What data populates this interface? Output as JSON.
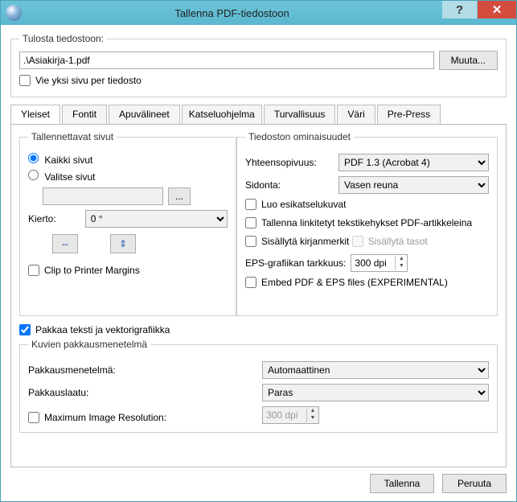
{
  "window": {
    "title": "Tallenna PDF-tiedostoon"
  },
  "print_to": {
    "legend": "Tulosta tiedostoon:",
    "path_value": ".\\Asiakirja-1.pdf",
    "change_btn": "Muuta...",
    "one_page_per_file": "Vie yksi sivu per tiedosto"
  },
  "tabs": {
    "general": "Yleiset",
    "fonts": "Fontit",
    "tools": "Apuvälineet",
    "viewer": "Katseluohjelma",
    "security": "Turvallisuus",
    "color": "Väri",
    "prepress": "Pre-Press"
  },
  "pages": {
    "legend": "Tallennettavat sivut",
    "all": "Kaikki sivut",
    "choose": "Valitse sivut",
    "dots": "...",
    "rotation_label": "Kierto:",
    "rotation_value": "0 °",
    "clip": "Clip to Printer Margins"
  },
  "fileopts": {
    "legend": "Tiedoston ominaisuudet",
    "compat_label": "Yhteensopivuus:",
    "compat_value": "PDF 1.3 (Acrobat 4)",
    "binding_label": "Sidonta:",
    "binding_value": "Vasen reuna",
    "thumbs": "Luo esikatselukuvat",
    "linked_frames": "Tallenna linkitetyt tekstikehykset PDF-artikkeleina",
    "bookmarks": "Sisällytä kirjanmerkit",
    "layers": "Sisällytä tasot",
    "eps_res_label": "EPS-grafiikan tarkkuus:",
    "eps_res_value": "300 dpi",
    "embed_eps": "Embed PDF & EPS files (EXPERIMENTAL)"
  },
  "compress_text": "Pakkaa teksti ja vektorigrafiikka",
  "imgcomp": {
    "legend": "Kuvien pakkausmenetelmä",
    "method_label": "Pakkausmenetelmä:",
    "method_value": "Automaattinen",
    "quality_label": "Pakkauslaatu:",
    "quality_value": "Paras",
    "maxres_label": "Maximum Image Resolution:",
    "maxres_value": "300 dpi"
  },
  "footer": {
    "save": "Tallenna",
    "cancel": "Peruuta"
  }
}
